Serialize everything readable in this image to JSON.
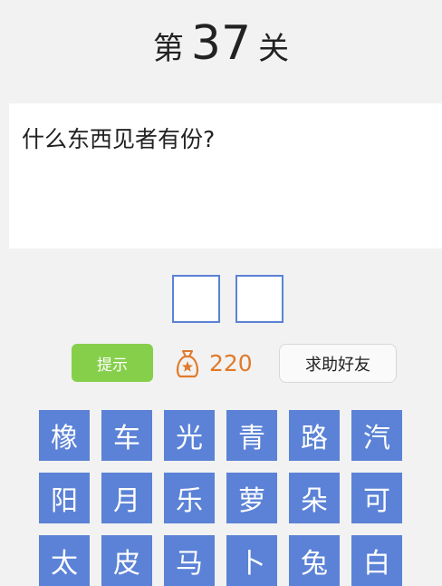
{
  "level": {
    "prefix": "第",
    "number": "37",
    "suffix": "关"
  },
  "question": {
    "text": "什么东西见者有份?"
  },
  "actions": {
    "hint_label": "提示",
    "coins": "220",
    "help_label": "求助好友"
  },
  "letters": {
    "row1": [
      "橡",
      "车",
      "光",
      "青",
      "路",
      "汽"
    ],
    "row2": [
      "阳",
      "月",
      "乐",
      "萝",
      "朵",
      "可"
    ],
    "row3": [
      "太",
      "皮",
      "马",
      "卜",
      "兔",
      "白"
    ]
  },
  "colors": {
    "tile": "#5b82d6",
    "hint": "#86cf4b",
    "coin": "#e07a2a"
  }
}
